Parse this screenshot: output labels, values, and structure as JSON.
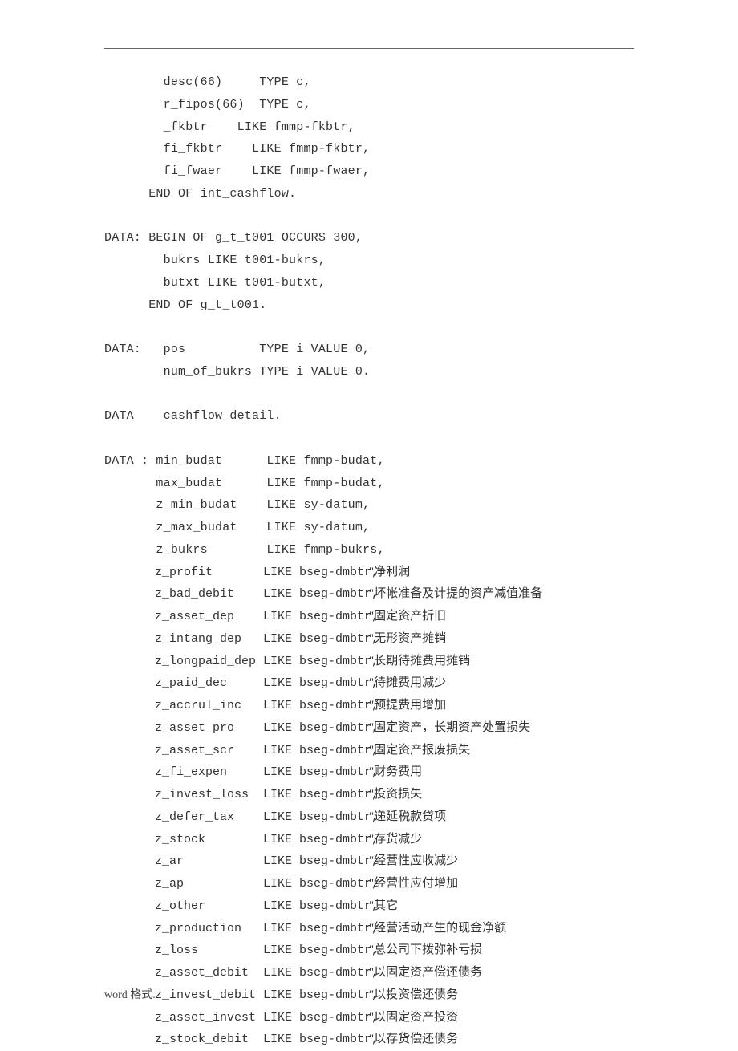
{
  "code": {
    "block1": "        desc(66)     TYPE c,\n        r_fipos(66)  TYPE c,\n        _fkbtr    LIKE fmmp-fkbtr,\n        fi_fkbtr    LIKE fmmp-fkbtr,\n        fi_fwaer    LIKE fmmp-fwaer,\n      END OF int_cashflow.",
    "block2": "DATA: BEGIN OF g_t_t001 OCCURS 300,\n        bukrs LIKE t001-bukrs,\n        butxt LIKE t001-butxt,\n      END OF g_t_t001.",
    "block3": "DATA:   pos          TYPE i VALUE 0,\n        num_of_bukrs TYPE i VALUE 0.",
    "block4": "DATA    cashflow_detail.",
    "block5_head": "DATA : min_budat      LIKE fmmp-budat,\n       max_budat      LIKE fmmp-budat,\n       z_min_budat    LIKE sy-datum,\n       z_max_budat    LIKE sy-datum,\n       z_bukrs        LIKE fmmp-bukrs,"
  },
  "rows": [
    {
      "decl": "       z_profit       LIKE bseg-dmbtr,",
      "comment": "\"净利润"
    },
    {
      "decl": "       z_bad_debit    LIKE bseg-dmbtr,",
      "comment": "\"坏帐准备及计提的资产减值准备"
    },
    {
      "decl": "       z_asset_dep    LIKE bseg-dmbtr,",
      "comment": "\"固定资产折旧"
    },
    {
      "decl": "       z_intang_dep   LIKE bseg-dmbtr,",
      "comment": "\"无形资产摊销"
    },
    {
      "decl": "       z_longpaid_dep LIKE bseg-dmbtr,",
      "comment": "\"长期待摊费用摊销"
    },
    {
      "decl": "       z_paid_dec     LIKE bseg-dmbtr,",
      "comment": "\"待摊费用减少"
    },
    {
      "decl": "       z_accrul_inc   LIKE bseg-dmbtr,",
      "comment": "\"预提费用增加"
    },
    {
      "decl": "       z_asset_pro    LIKE bseg-dmbtr,",
      "comment": "\"固定资产，长期资产处置损失"
    },
    {
      "decl": "       z_asset_scr    LIKE bseg-dmbtr,",
      "comment": "\"固定资产报废损失"
    },
    {
      "decl": "       z_fi_expen     LIKE bseg-dmbtr,",
      "comment": "\"财务费用"
    },
    {
      "decl": "       z_invest_loss  LIKE bseg-dmbtr,",
      "comment": "\"投资损失"
    },
    {
      "decl": "       z_defer_tax    LIKE bseg-dmbtr,",
      "comment": "\"递延税款贷项"
    },
    {
      "decl": "       z_stock        LIKE bseg-dmbtr,",
      "comment": "\"存货减少"
    },
    {
      "decl": "       z_ar           LIKE bseg-dmbtr,",
      "comment": "\"经营性应收减少"
    },
    {
      "decl": "       z_ap           LIKE bseg-dmbtr,",
      "comment": "\"经营性应付增加"
    },
    {
      "decl": "       z_other        LIKE bseg-dmbtr,",
      "comment": "\"其它"
    },
    {
      "decl": "       z_production   LIKE bseg-dmbtr,",
      "comment": "\"经营活动产生的现金净额"
    },
    {
      "decl": "       z_loss         LIKE bseg-dmbtr,",
      "comment": "\"总公司下拨弥补亏损"
    },
    {
      "decl": "       z_asset_debit  LIKE bseg-dmbtr,",
      "comment": "\"以固定资产偿还债务"
    },
    {
      "decl": "       z_invest_debit LIKE bseg-dmbtr,",
      "comment": "\"以投资偿还债务"
    },
    {
      "decl": "       z_asset_invest LIKE bseg-dmbtr,",
      "comment": "\"以固定资产投资"
    },
    {
      "decl": "       z_stock_debit  LIKE bseg-dmbtr,",
      "comment": "\"以存货偿还债务"
    }
  ],
  "footer": "word 格式."
}
